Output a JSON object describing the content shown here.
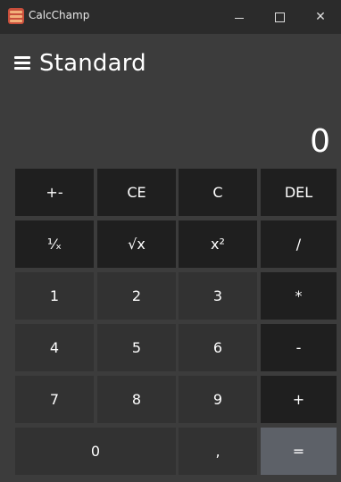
{
  "window": {
    "title": "CalcChamp",
    "controls": {
      "minimize": "minimize",
      "maximize": "maximize",
      "close": "close"
    }
  },
  "header": {
    "mode_title": "Standard"
  },
  "display": {
    "value": "0"
  },
  "keys": {
    "row1": [
      "+-",
      "CE",
      "C",
      "DEL"
    ],
    "row2": [
      "¹⁄ₓ",
      "√x",
      "x²",
      "/"
    ],
    "row3": [
      "1",
      "2",
      "3",
      "*"
    ],
    "row4": [
      "4",
      "5",
      "6",
      "-"
    ],
    "row5": [
      "7",
      "8",
      "9",
      "+"
    ],
    "row6": [
      "0",
      ",",
      "="
    ]
  },
  "colors": {
    "window_bg": "#3c3c3c",
    "titlebar_bg": "#2b2b2b",
    "key_fn": "#1f1f1f",
    "key_num": "#323232",
    "key_equals": "#5d6168"
  }
}
